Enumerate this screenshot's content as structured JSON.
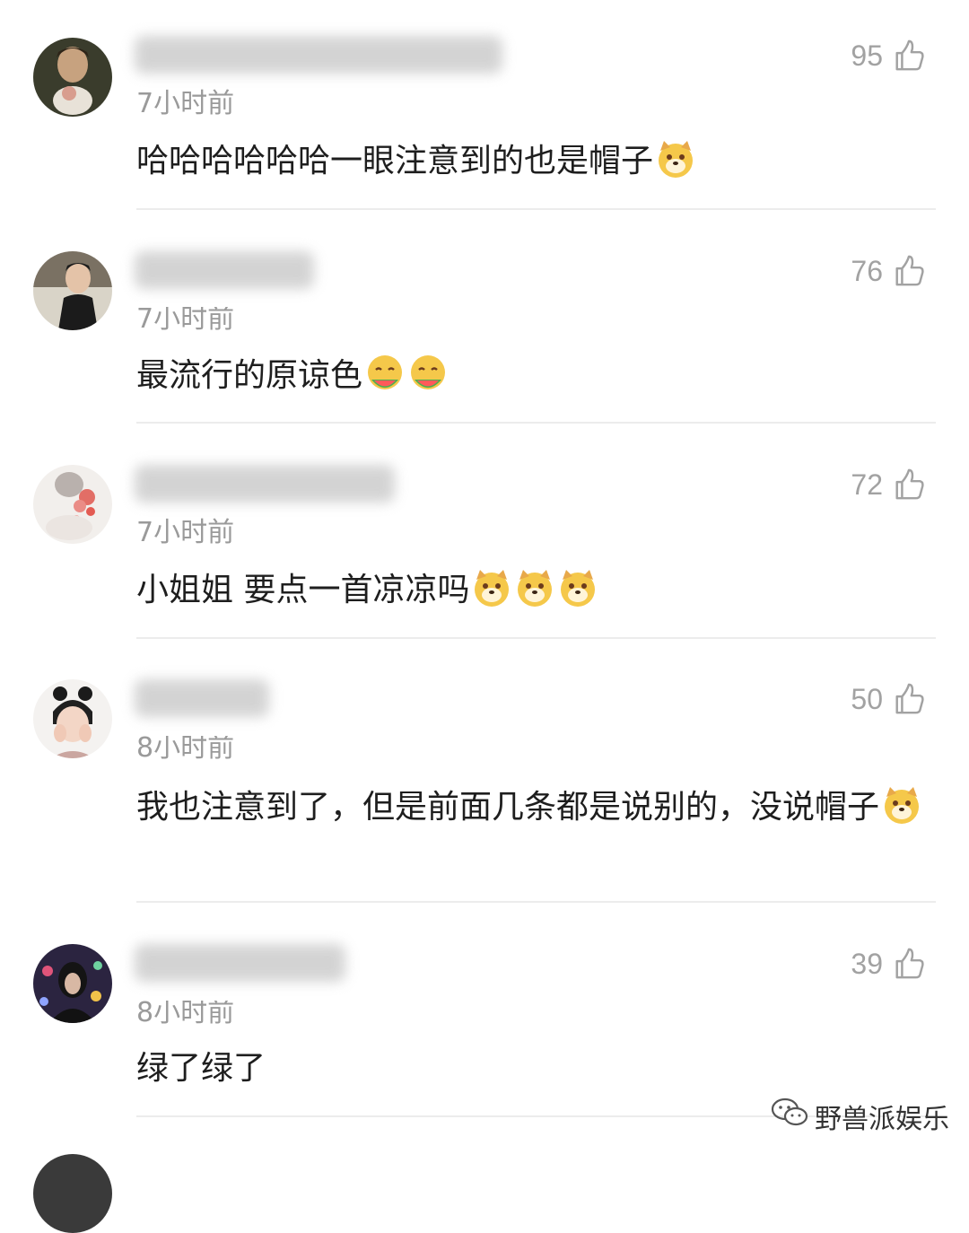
{
  "comments": [
    {
      "likes": "95",
      "time": "7小时前",
      "text": "哈哈哈哈哈哈一眼注意到的也是帽子",
      "emojis": [
        "doge-emoji"
      ]
    },
    {
      "likes": "76",
      "time": "7小时前",
      "text": "最流行的原谅色",
      "emojis": [
        "melon-eating-emoji",
        "melon-eating-emoji"
      ]
    },
    {
      "likes": "72",
      "time": "7小时前",
      "text": "小姐姐 要点一首凉凉吗",
      "emojis": [
        "doge-emoji",
        "doge-emoji",
        "doge-emoji"
      ]
    },
    {
      "likes": "50",
      "time": "8小时前",
      "text": "我也注意到了，但是前面几条都是说别的，没说帽子",
      "emojis": [
        "doge-emoji"
      ]
    },
    {
      "likes": "39",
      "time": "8小时前",
      "text": "绿了绿了",
      "emojis": []
    }
  ],
  "icons": {
    "like": "thumbs-up-icon",
    "watermark": "wechat-icon"
  },
  "watermark": {
    "label": "野兽派娱乐"
  },
  "colors": {
    "meta_gray": "#9a9a9a",
    "divider": "#ececec",
    "emoji_yellow": "#f5c84a"
  }
}
